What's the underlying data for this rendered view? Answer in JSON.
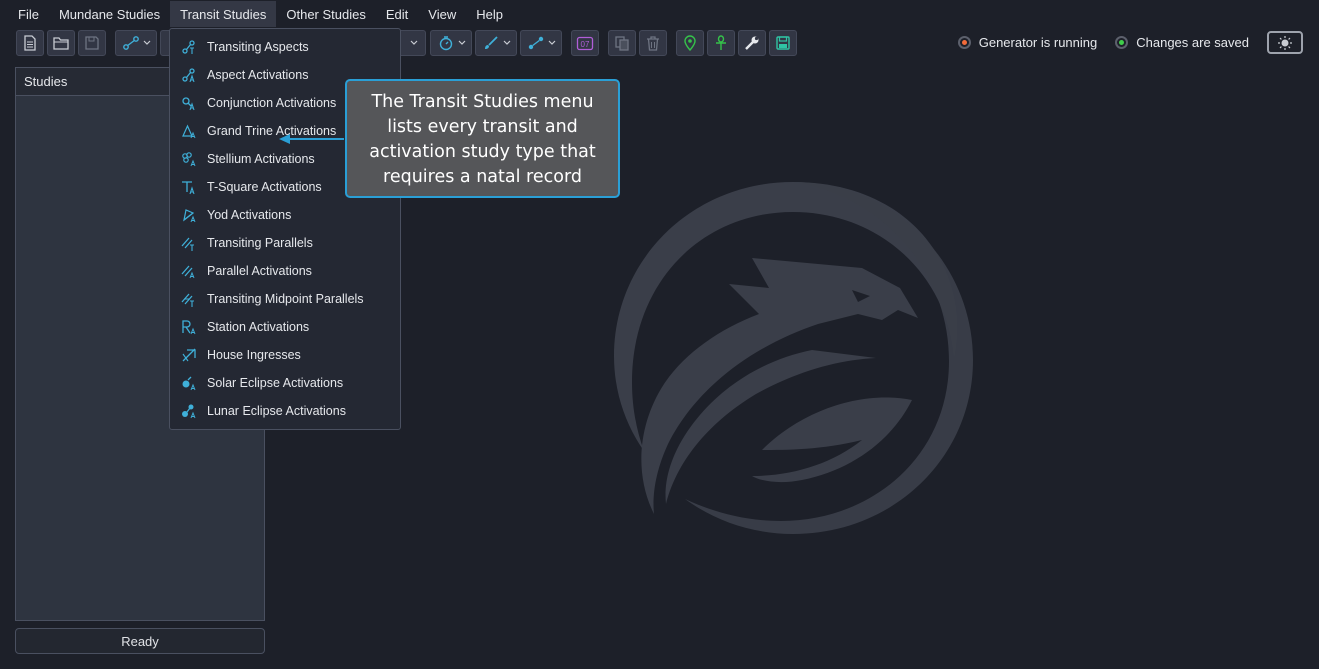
{
  "menubar": {
    "items": [
      "File",
      "Mundane Studies",
      "Transit Studies",
      "Other Studies",
      "Edit",
      "View",
      "Help"
    ],
    "active_index": 2
  },
  "toolbar": {
    "date_badge": "07"
  },
  "status": {
    "generator": "Generator is running",
    "saved": "Changes are saved",
    "generator_color": "#f26b3a",
    "saved_color": "#3fce4a"
  },
  "panel": {
    "title": "Studies"
  },
  "footer": {
    "ready": "Ready"
  },
  "transit_menu": {
    "items": [
      {
        "label": "Transiting Aspects",
        "icon": "transiting-aspects-icon"
      },
      {
        "label": "Aspect Activations",
        "icon": "aspect-activations-icon"
      },
      {
        "label": "Conjunction Activations",
        "icon": "conjunction-activations-icon"
      },
      {
        "label": "Grand Trine Activations",
        "icon": "grand-trine-icon"
      },
      {
        "label": "Stellium Activations",
        "icon": "stellium-icon"
      },
      {
        "label": "T-Square Activations",
        "icon": "t-square-icon"
      },
      {
        "label": "Yod Activations",
        "icon": "yod-icon"
      },
      {
        "label": "Transiting Parallels",
        "icon": "transiting-parallels-icon"
      },
      {
        "label": "Parallel Activations",
        "icon": "parallel-activations-icon"
      },
      {
        "label": "Transiting Midpoint Parallels",
        "icon": "midpoint-parallels-icon"
      },
      {
        "label": "Station Activations",
        "icon": "station-icon"
      },
      {
        "label": "House Ingresses",
        "icon": "house-ingress-icon"
      },
      {
        "label": "Solar Eclipse Activations",
        "icon": "solar-eclipse-icon"
      },
      {
        "label": "Lunar Eclipse Activations",
        "icon": "lunar-eclipse-icon"
      }
    ]
  },
  "callout": {
    "text": "The Transit Studies menu lists every transit and activation study type that requires a natal record"
  },
  "colors": {
    "accent": "#2a9fd6",
    "icon": "#3fb0d9",
    "background": "#1d2029"
  }
}
